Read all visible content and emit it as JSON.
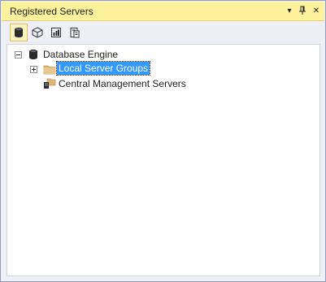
{
  "window": {
    "title": "Registered Servers",
    "buttons": {
      "menu_glyph": "▾",
      "pin_glyph": "⊥",
      "close_glyph": "✕"
    }
  },
  "toolbar": {
    "tools": [
      {
        "name": "database-engine",
        "icon": "database-cylinder-icon",
        "active": true
      },
      {
        "name": "analysis-services",
        "icon": "cube-icon",
        "active": false
      },
      {
        "name": "reporting-services",
        "icon": "report-icon",
        "active": false
      },
      {
        "name": "integration-services",
        "icon": "package-icon",
        "active": false
      }
    ]
  },
  "tree": {
    "root": {
      "label": "Database Engine",
      "expanded": true
    },
    "children": [
      {
        "label": "Local Server Groups",
        "has_children": true,
        "selected": true,
        "icon": "folder-icon"
      },
      {
        "label": "Central Management Servers",
        "has_children": false,
        "selected": false,
        "icon": "server-folder-icon"
      }
    ]
  },
  "colors": {
    "title_bar": "#fff29d",
    "selection": "#3399ff",
    "panel_bg": "#eef0f5"
  }
}
